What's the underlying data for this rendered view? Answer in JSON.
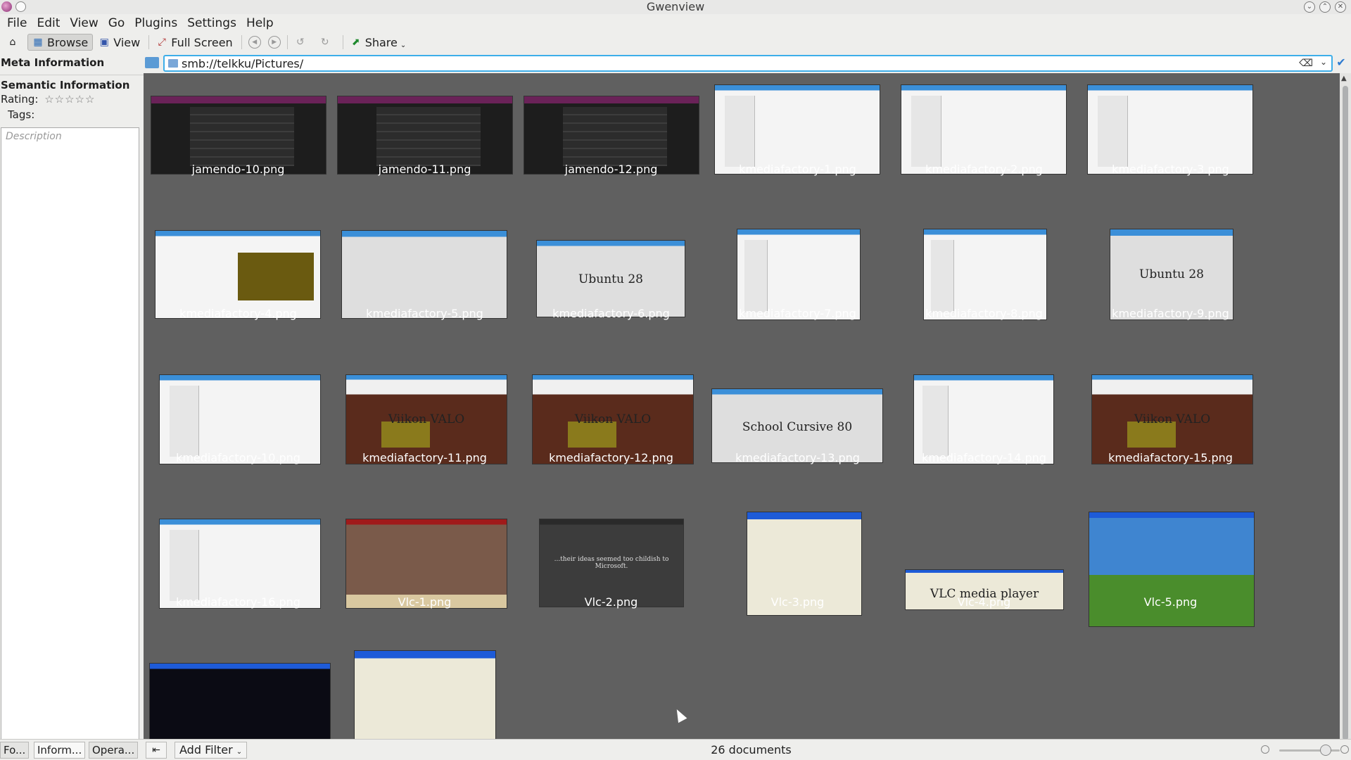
{
  "window": {
    "title": "Gwenview"
  },
  "menu": [
    "File",
    "Edit",
    "View",
    "Go",
    "Plugins",
    "Settings",
    "Help"
  ],
  "toolbar": {
    "browse": "Browse",
    "view": "View",
    "fullscreen": "Full Screen",
    "share": "Share"
  },
  "sidebar": {
    "meta_heading": "Meta Information",
    "semantic_heading": "Semantic Information",
    "rating_label": "Rating:",
    "rating_stars": "☆☆☆☆☆",
    "tags_label": "Tags:",
    "description_placeholder": "Description"
  },
  "urlbar": {
    "path": "smb://telkku/Pictures/"
  },
  "thumbnails": [
    {
      "name": "jamendo-10.png",
      "style": "dark"
    },
    {
      "name": "jamendo-11.png",
      "style": "dark"
    },
    {
      "name": "jamendo-12.png",
      "style": "dark"
    },
    {
      "name": "kmediafactory-1.png",
      "style": "kde"
    },
    {
      "name": "kmediafactory-2.png",
      "style": "kde"
    },
    {
      "name": "kmediafactory-3.png",
      "style": "kde"
    },
    {
      "name": "kmediafactory-4.png",
      "style": "cat"
    },
    {
      "name": "kmediafactory-5.png",
      "style": "dialog"
    },
    {
      "name": "kmediafactory-6.png",
      "style": "dialog",
      "text": "Ubuntu 28"
    },
    {
      "name": "kmediafactory-7.png",
      "style": "kde"
    },
    {
      "name": "kmediafactory-8.png",
      "style": "kde"
    },
    {
      "name": "kmediafactory-9.png",
      "style": "dialog",
      "text": "Ubuntu 28"
    },
    {
      "name": "kmediafactory-10.png",
      "style": "kde"
    },
    {
      "name": "kmediafactory-11.png",
      "style": "brown",
      "text": "Viikon VALO"
    },
    {
      "name": "kmediafactory-12.png",
      "style": "brown",
      "text": "Viikon VALO"
    },
    {
      "name": "kmediafactory-13.png",
      "style": "dialog",
      "text": "School Cursive 80"
    },
    {
      "name": "kmediafactory-14.png",
      "style": "kde"
    },
    {
      "name": "kmediafactory-15.png",
      "style": "brown",
      "text": "Viikon VALO"
    },
    {
      "name": "kmediafactory-16.png",
      "style": "kde"
    },
    {
      "name": "Vlc-1.png",
      "style": "street"
    },
    {
      "name": "Vlc-2.png",
      "style": "night",
      "text": "...their ideas seemed too childish to Microsoft."
    },
    {
      "name": "Vlc-3.png",
      "style": "xp"
    },
    {
      "name": "Vlc-4.png",
      "style": "xp",
      "text": "VLC media player"
    },
    {
      "name": "Vlc-5.png",
      "style": "green"
    },
    {
      "name": "",
      "style": "space"
    },
    {
      "name": "",
      "style": "xp"
    }
  ],
  "statusbar": {
    "tab_folders": "Fo...",
    "tab_information": "Inform...",
    "tab_operations": "Opera...",
    "add_filter": "Add Filter",
    "document_count": "26 documents"
  }
}
